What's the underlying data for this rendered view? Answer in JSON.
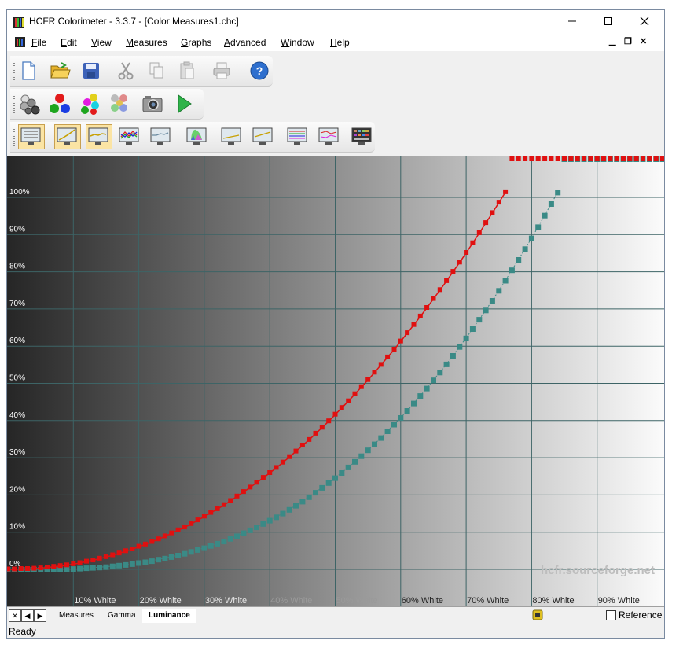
{
  "window": {
    "title": "HCFR Colorimeter - 3.3.7 - [Color Measures1.chc]"
  },
  "menu": [
    "File",
    "Edit",
    "View",
    "Measures",
    "Graphs",
    "Advanced",
    "Window",
    "Help"
  ],
  "icons": {
    "toolbar1": [
      "new-document-icon",
      "open-folder-icon",
      "save-icon",
      "cut-icon",
      "copy-icon",
      "paste-icon",
      "print-icon",
      "help-icon"
    ],
    "toolbar2": [
      "grayscale-spheres-icon",
      "primary-colors-icon",
      "secondary-colors-icon",
      "saturation-spheres-icon",
      "camera-icon",
      "play-icon"
    ],
    "toolbar3": [
      "measures-view-icon",
      "gamma-view-icon",
      "luminance-view-icon",
      "rgb-levels-view-icon",
      "color-temp-view-icon",
      "cie-chart-view-icon",
      "near-black-view-icon",
      "near-white-view-icon",
      "saturation-luma-view-icon",
      "saturation-shift-view-icon",
      "colorchecker-view-icon"
    ]
  },
  "graph": {
    "watermark": "hcfr.sourceforge.net",
    "colors": {
      "measured": "#e01010",
      "reference": "#3a8a86",
      "grid": "#3d6466"
    }
  },
  "chart_data": {
    "type": "line",
    "x_tick_labels": [
      "10% White",
      "20% White",
      "30% White",
      "40% White",
      "50% White",
      "60% White",
      "70% White",
      "80% White",
      "90% White"
    ],
    "y_tick_labels": [
      "0%",
      "10%",
      "20%",
      "30%",
      "40%",
      "50%",
      "60%",
      "70%",
      "80%",
      "90%",
      "100%"
    ],
    "xlim": [
      0,
      100
    ],
    "ylim": [
      0,
      100
    ],
    "x": [
      0,
      1,
      2,
      3,
      4,
      5,
      6,
      7,
      8,
      9,
      10,
      11,
      12,
      13,
      14,
      15,
      16,
      17,
      18,
      19,
      20,
      21,
      22,
      23,
      24,
      25,
      26,
      27,
      28,
      29,
      30,
      31,
      32,
      33,
      34,
      35,
      36,
      37,
      38,
      39,
      40,
      41,
      42,
      43,
      44,
      45,
      46,
      47,
      48,
      49,
      50,
      51,
      52,
      53,
      54,
      55,
      56,
      57,
      58,
      59,
      60,
      61,
      62,
      63,
      64,
      65,
      66,
      67,
      68,
      69,
      70,
      71,
      72,
      73,
      74,
      75,
      76,
      77,
      78,
      79,
      80,
      81,
      82,
      83,
      84,
      85,
      86,
      87,
      88,
      89,
      90,
      91,
      92,
      93,
      94,
      95,
      96,
      97,
      98,
      99,
      100
    ],
    "series": [
      {
        "values": [
          0,
          0,
          0.1,
          0.1,
          0.2,
          0.3,
          0.5,
          0.7,
          0.9,
          1.1,
          1.4,
          1.7,
          2.1,
          2.4,
          2.9,
          3.3,
          3.8,
          4.3,
          4.9,
          5.4,
          6.1,
          6.7,
          7.4,
          8.1,
          8.9,
          9.7,
          10.5,
          11.3,
          12.2,
          13.2,
          14.2,
          15.2,
          16.2,
          17.3,
          18.4,
          19.6,
          20.8,
          22,
          23.3,
          24.6,
          25.9,
          27.3,
          28.7,
          30.2,
          31.7,
          33.3,
          34.8,
          36.5,
          38.1,
          39.8,
          41.6,
          43.4,
          45.2,
          47.1,
          49,
          50.9,
          52.9,
          55,
          57,
          59.1,
          61.3,
          63.5,
          65.7,
          68,
          70.3,
          72.7,
          75.1,
          77.5,
          80,
          82.5,
          85.1,
          87.7,
          90.4,
          93.1,
          95.8,
          98.6,
          101.4
        ]
      },
      {
        "values": [
          0,
          0,
          0,
          0,
          0,
          0,
          0.1,
          0.1,
          0.1,
          0.2,
          0.2,
          0.3,
          0.4,
          0.5,
          0.6,
          0.7,
          0.9,
          1.1,
          1.3,
          1.5,
          1.8,
          2,
          2.3,
          2.7,
          3,
          3.4,
          3.8,
          4.3,
          4.8,
          5.3,
          5.8,
          6.4,
          7,
          7.6,
          8.3,
          9,
          9.8,
          10.6,
          11.4,
          12.3,
          13.2,
          14.1,
          15.1,
          16.1,
          17.2,
          18.3,
          19.5,
          20.7,
          22,
          23.3,
          24.6,
          26,
          27.5,
          29,
          30.5,
          32.1,
          33.7,
          35.4,
          37.2,
          39,
          40.8,
          42.7,
          44.7,
          46.7,
          48.7,
          50.9,
          53,
          55.2,
          57.5,
          59.9,
          62.2,
          64.7,
          67.2,
          69.7,
          72.3,
          75,
          77.7,
          80.5,
          83.3,
          86.2,
          89.1,
          92.1,
          95.2,
          98.3,
          101.4
        ]
      }
    ]
  },
  "tabs": [
    "Measures",
    "Gamma",
    "Luminance"
  ],
  "active_tab": "Luminance",
  "reference_label": "Reference",
  "status": "Ready"
}
